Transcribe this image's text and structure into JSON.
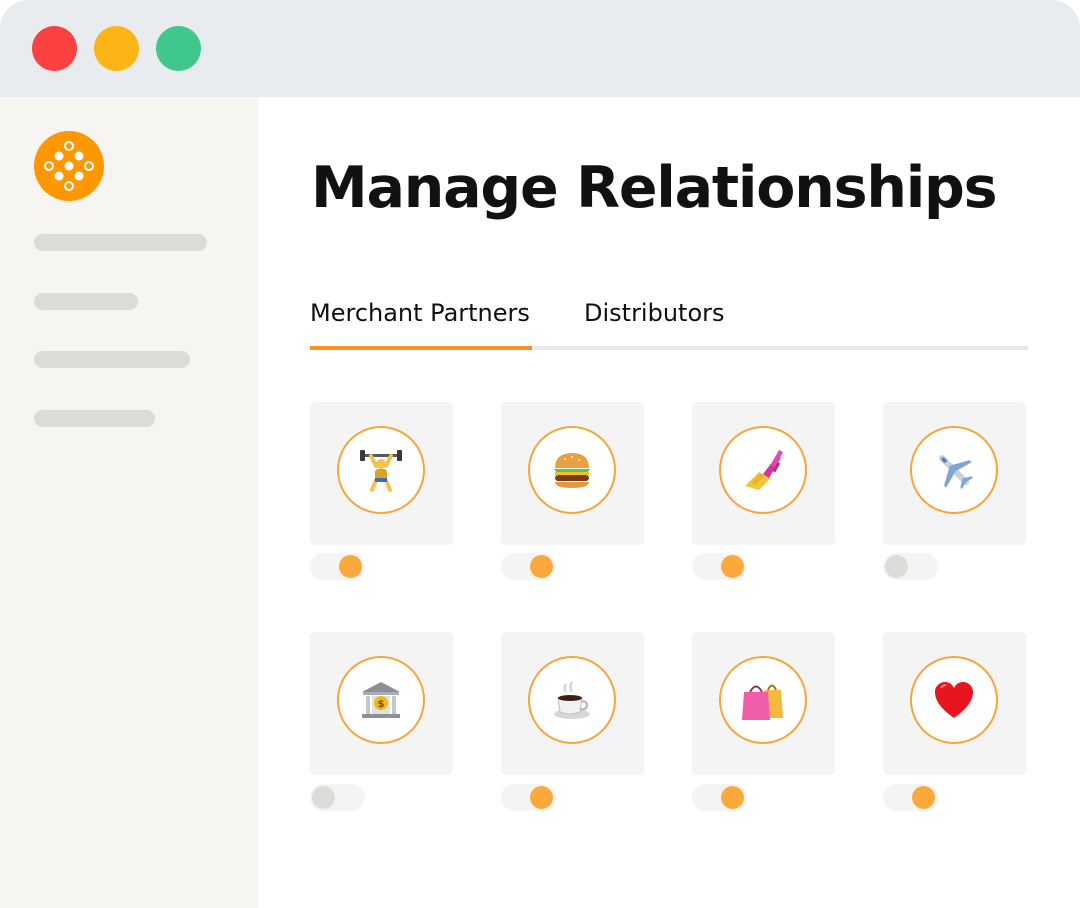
{
  "window": {
    "controls": [
      "close-dot",
      "minimize-dot",
      "zoom-dot"
    ]
  },
  "colors": {
    "accent": "#f7931e",
    "toggle_on": "#fba83c",
    "toggle_off": "#dddcd9",
    "close": "#fc4142",
    "minimize": "#fdb416",
    "zoom": "#40c78b"
  },
  "sidebar": {
    "logo_icon": "grid-dots-logo-icon"
  },
  "main": {
    "title": "Manage Relationships",
    "tabs": [
      {
        "label": "Merchant Partners",
        "active": true
      },
      {
        "label": "Distributors",
        "active": false
      }
    ],
    "partners": [
      {
        "icon": "weightlifter-icon",
        "enabled": true
      },
      {
        "icon": "burger-icon",
        "enabled": true
      },
      {
        "icon": "nail-polish-icon",
        "enabled": true
      },
      {
        "icon": "airplane-icon",
        "enabled": false
      },
      {
        "icon": "bank-icon",
        "enabled": false
      },
      {
        "icon": "coffee-icon",
        "enabled": true
      },
      {
        "icon": "shopping-bags-icon",
        "enabled": true
      },
      {
        "icon": "heart-icon",
        "enabled": true
      }
    ]
  }
}
